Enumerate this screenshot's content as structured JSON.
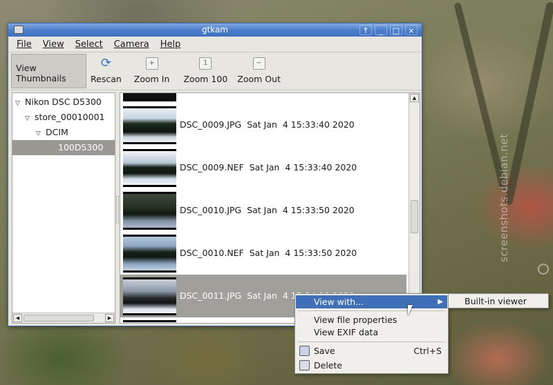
{
  "window": {
    "title": "gtkam"
  },
  "titlebar_buttons": [
    "↑",
    "_",
    "□",
    "×"
  ],
  "menubar": [
    {
      "label": "File"
    },
    {
      "label": "View"
    },
    {
      "label": "Select"
    },
    {
      "label": "Camera"
    },
    {
      "label": "Help"
    }
  ],
  "toolbar": [
    {
      "label": "View Thumbnails",
      "icon": "view-thumbnails-icon",
      "active": true
    },
    {
      "label": "Rescan",
      "icon": "rescan-icon"
    },
    {
      "label": "Zoom In",
      "icon": "zoom-in-icon"
    },
    {
      "label": "Zoom 100",
      "icon": "zoom-100-icon"
    },
    {
      "label": "Zoom Out",
      "icon": "zoom-out-icon"
    }
  ],
  "tree": [
    {
      "label": "Nikon DSC D5300",
      "expanded": true
    },
    {
      "label": "store_00010001",
      "expanded": true
    },
    {
      "label": "DCIM",
      "expanded": true
    },
    {
      "label": "100D5300",
      "selected": true
    }
  ],
  "files": [
    {
      "name": "DSC_0009.JPG",
      "date": "Sat Jan  4 15:33:40 2020"
    },
    {
      "name": "DSC_0009.NEF",
      "date": "Sat Jan  4 15:33:40 2020"
    },
    {
      "name": "DSC_0010.JPG",
      "date": "Sat Jan  4 15:33:50 2020"
    },
    {
      "name": "DSC_0010.NEF",
      "date": "Sat Jan  4 15:33:50 2020"
    },
    {
      "name": "DSC_0011.JPG",
      "date": "Sat Jan  4 15:34:00 2020",
      "selected": true
    }
  ],
  "context_menu": {
    "view_with": "View with...",
    "view_file_properties": "View file properties",
    "view_exif": "View EXIF data",
    "save": "Save",
    "save_shortcut": "Ctrl+S",
    "delete": "Delete"
  },
  "submenu": {
    "builtin_viewer": "Built-in viewer"
  },
  "watermark": "screenshots.debian.net",
  "colors": {
    "title_blue": "#4d7fcc",
    "highlight": "#3f6fb6",
    "selected_row": "#a19f9a"
  }
}
